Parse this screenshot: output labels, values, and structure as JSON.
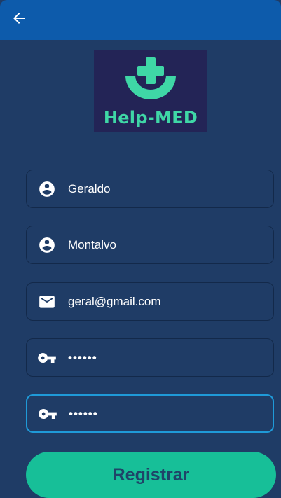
{
  "app": {
    "logo_text": "Help-MED"
  },
  "form": {
    "first_name": "Geraldo",
    "last_name": "Montalvo",
    "email": "geral@gmail.com",
    "password": "••••••",
    "confirm_password": "••••••"
  },
  "actions": {
    "register_label": "Registrar"
  },
  "icons": {
    "back": "arrow-back-icon",
    "person": "person-icon",
    "email": "email-icon",
    "key": "key-icon"
  },
  "colors": {
    "appbar": "#0d5bab",
    "background": "#1f3c66",
    "brand_green": "#3fd7a6",
    "button": "#17bf98",
    "focus": "#1f9ad8"
  }
}
